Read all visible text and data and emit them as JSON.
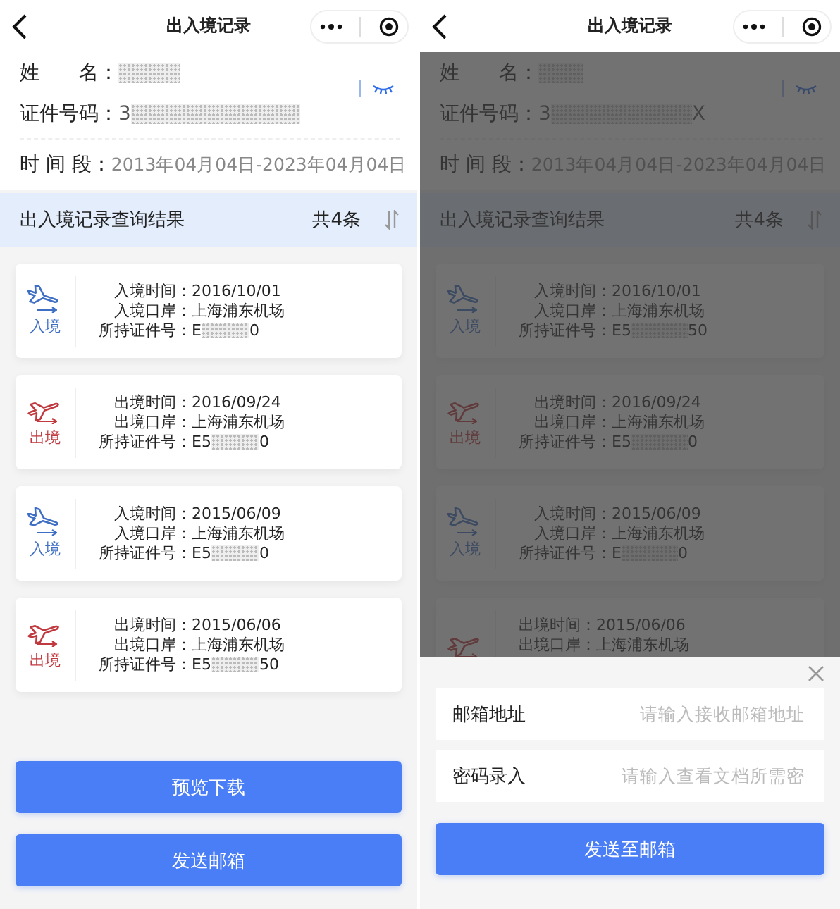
{
  "screens": [
    {
      "nav": {
        "title": "出入境记录"
      },
      "profile": {
        "name_label": "姓　　名：",
        "id_label": "证件号码：",
        "id_start": "3",
        "period_label": "时 间 段：",
        "period": "2013年04月04日-2023年04月04日"
      },
      "results": {
        "title": "出入境记录查询结果",
        "count": "共4条"
      },
      "records": [
        {
          "kind": "entry",
          "tag": "入境",
          "fields": [
            {
              "kind": "plain",
              "label": "入境时间：",
              "value": "2016/10/01"
            },
            {
              "kind": "plain",
              "label": "入境口岸：",
              "value": "上海浦东机场"
            },
            {
              "kind": "masked",
              "label": "所持证件号：",
              "value_start": "E",
              "value_end": "0"
            }
          ]
        },
        {
          "kind": "exit",
          "tag": "出境",
          "fields": [
            {
              "kind": "plain",
              "label": "出境时间：",
              "value": "2016/09/24"
            },
            {
              "kind": "plain",
              "label": "出境口岸：",
              "value": "上海浦东机场"
            },
            {
              "kind": "masked",
              "label": "所持证件号：",
              "value_start": "E5",
              "value_end": "0"
            }
          ]
        },
        {
          "kind": "entry",
          "tag": "入境",
          "fields": [
            {
              "kind": "plain",
              "label": "入境时间：",
              "value": "2015/06/09"
            },
            {
              "kind": "plain",
              "label": "入境口岸：",
              "value": "上海浦东机场"
            },
            {
              "kind": "masked",
              "label": "所持证件号：",
              "value_start": "E5",
              "value_end": "0"
            }
          ]
        },
        {
          "kind": "exit",
          "tag": "出境",
          "fields": [
            {
              "kind": "plain",
              "label": "出境时间：",
              "value": "2015/06/06"
            },
            {
              "kind": "plain",
              "label": "出境口岸：",
              "value": "上海浦东机场"
            },
            {
              "kind": "masked",
              "label": "所持证件号：",
              "value_start": "E5",
              "value_end": "50"
            }
          ]
        }
      ],
      "buttons": [
        "预览下载",
        "发送邮箱"
      ]
    },
    {
      "nav": {
        "title": "出入境记录"
      },
      "profile": {
        "name_label": "姓　　名：",
        "id_label": "证件号码：",
        "id_start": "3",
        "id_end": "X",
        "period_label": "时 间 段：",
        "period": "2013年04月04日-2023年04月04日"
      },
      "results": {
        "title": "出入境记录查询结果",
        "count": "共4条"
      },
      "records": [
        {
          "kind": "entry",
          "tag": "入境",
          "fields": [
            {
              "kind": "plain",
              "label": "入境时间：",
              "value": "2016/10/01"
            },
            {
              "kind": "plain",
              "label": "入境口岸：",
              "value": "上海浦东机场"
            },
            {
              "kind": "masked",
              "label": "所持证件号：",
              "value_start": "E5",
              "value_end": "50"
            }
          ]
        },
        {
          "kind": "exit",
          "tag": "出境",
          "fields": [
            {
              "kind": "plain",
              "label": "出境时间：",
              "value": "2016/09/24"
            },
            {
              "kind": "plain",
              "label": "出境口岸：",
              "value": "上海浦东机场"
            },
            {
              "kind": "masked",
              "label": "所持证件号：",
              "value_start": "E5",
              "value_end": "0"
            }
          ]
        },
        {
          "kind": "entry",
          "tag": "入境",
          "fields": [
            {
              "kind": "plain",
              "label": "入境时间：",
              "value": "2015/06/09"
            },
            {
              "kind": "plain",
              "label": "入境口岸：",
              "value": "上海浦东机场"
            },
            {
              "kind": "masked",
              "label": "所持证件号：",
              "value_start": "E",
              "value_end": "0"
            }
          ]
        },
        {
          "kind": "exit",
          "fields": [
            {
              "kind": "plain",
              "label": "出境时间：",
              "value": "2015/06/06"
            },
            {
              "kind": "plain",
              "label": "出境口岸：",
              "value": "上海浦东机场"
            }
          ]
        }
      ],
      "sheet": {
        "fields": [
          {
            "label": "邮箱地址",
            "placeholder": "请输入接收邮箱地址"
          },
          {
            "label": "密码录入",
            "placeholder": "请输入查看文档所需密"
          }
        ],
        "button": "发送至邮箱"
      }
    }
  ]
}
